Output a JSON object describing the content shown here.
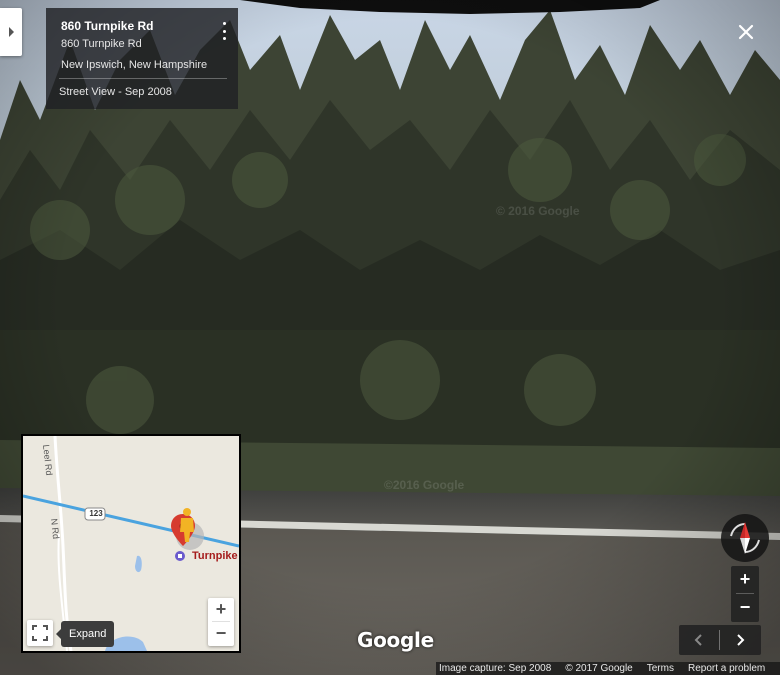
{
  "location_card": {
    "title": "860 Turnpike Rd",
    "address": "860 Turnpike Rd",
    "locality": "New Ipswich, New Hampshire",
    "imagery": "Street View - Sep 2008"
  },
  "minimap": {
    "road_labels": [
      "Leel Rd",
      "N Rd"
    ],
    "route_shield": "123",
    "place_label": "Turnpike",
    "expand_tooltip": "Expand",
    "zoom_in": "+",
    "zoom_out": "−"
  },
  "watermarks": [
    "© 2016 Google",
    "©2016 Google"
  ],
  "controls": {
    "zoom_in": "+",
    "zoom_out": "−"
  },
  "brand": "Google",
  "footer": {
    "capture": "Image capture: Sep 2008",
    "copyright": "© 2017 Google",
    "terms": "Terms",
    "report": "Report a problem"
  },
  "colors": {
    "route_blue": "#4aa3df",
    "pin_red": "#d63b2f",
    "pegman_yellow": "#f2b324",
    "card_bg": "#202124"
  }
}
